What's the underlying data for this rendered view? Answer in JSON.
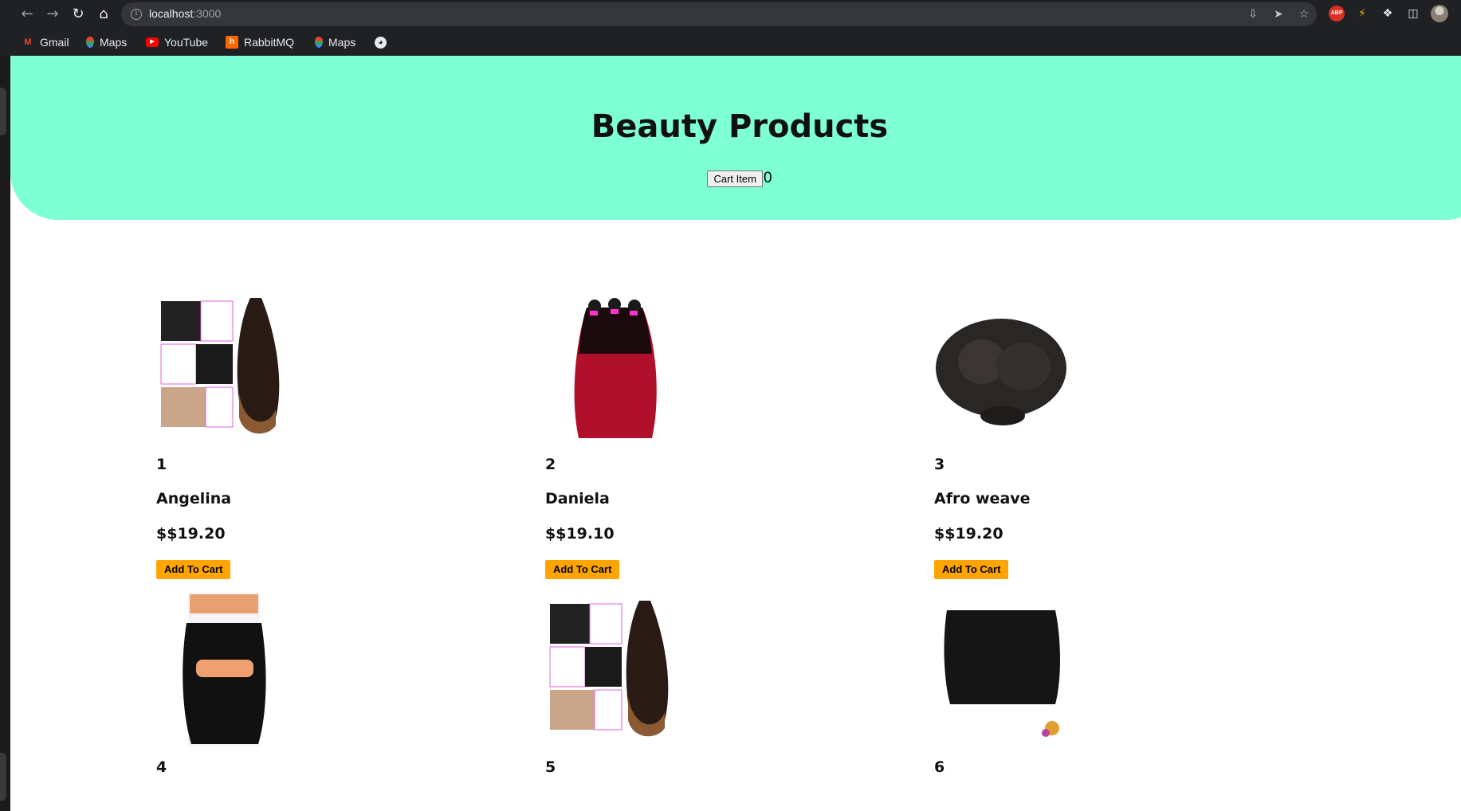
{
  "browser": {
    "url_host": "localhost",
    "url_port": ":3000",
    "bookmarks": [
      {
        "label": "Gmail",
        "icon": "gmail-icon"
      },
      {
        "label": "Maps",
        "icon": "maps-icon"
      },
      {
        "label": "YouTube",
        "icon": "youtube-icon"
      },
      {
        "label": "RabbitMQ",
        "icon": "rabbitmq-icon"
      },
      {
        "label": "Maps",
        "icon": "maps-icon"
      },
      {
        "label": "",
        "icon": "globe-icon"
      }
    ],
    "extension_badges": {
      "adblock": "ABP"
    }
  },
  "header": {
    "title": "Beauty Products",
    "cart_button_label": "Cart Item",
    "cart_count": "0",
    "background_color": "#7fffd4"
  },
  "products": [
    {
      "id": "1",
      "name": "Angelina",
      "price": "$$19.20",
      "add_label": "Add To Cart",
      "image": "crochet-braids-product-image"
    },
    {
      "id": "2",
      "name": "Daniela",
      "price": "$$19.10",
      "add_label": "Add To Cart",
      "image": "red-ombre-straight-hair-image"
    },
    {
      "id": "3",
      "name": "Afro weave",
      "price": "$$19.20",
      "add_label": "Add To Cart",
      "image": "afro-kinky-hair-image"
    },
    {
      "id": "4",
      "image": "reyna-curl-pack-image"
    },
    {
      "id": "5",
      "image": "crochet-braids-product-image"
    },
    {
      "id": "6",
      "image": "passion-twist-braids-image"
    }
  ],
  "colors": {
    "add_button": "#ffa500",
    "chrome_bg": "#202124"
  }
}
